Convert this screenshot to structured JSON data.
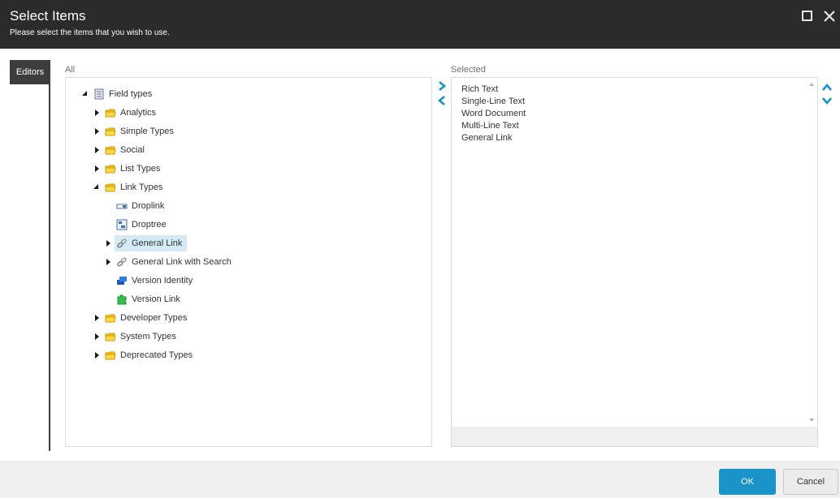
{
  "dialog": {
    "title": "Select Items",
    "subtitle": "Please select the items that you wish to use."
  },
  "sidebar": {
    "tab_label": "Editors"
  },
  "columns": {
    "all_label": "All",
    "selected_label": "Selected"
  },
  "tree": [
    {
      "label": "Field types",
      "icon": "template-icon",
      "state": "expanded"
    },
    {
      "label": "Analytics",
      "icon": "folder-icon",
      "state": "collapsed"
    },
    {
      "label": "Simple Types",
      "icon": "folder-icon",
      "state": "collapsed"
    },
    {
      "label": "Social",
      "icon": "folder-icon",
      "state": "collapsed"
    },
    {
      "label": "List Types",
      "icon": "folder-icon",
      "state": "collapsed"
    },
    {
      "label": "Link Types",
      "icon": "folder-icon",
      "state": "expanded"
    },
    {
      "label": "Droplink",
      "icon": "droplink-icon",
      "state": "leaf"
    },
    {
      "label": "Droptree",
      "icon": "droptree-icon",
      "state": "leaf"
    },
    {
      "label": "General Link",
      "icon": "link-chain-icon",
      "state": "collapsed",
      "selected": true
    },
    {
      "label": "General Link with Search",
      "icon": "link-chain-icon",
      "state": "collapsed"
    },
    {
      "label": "Version Identity",
      "icon": "version-identity-icon",
      "state": "leaf"
    },
    {
      "label": "Version Link",
      "icon": "puzzle-icon",
      "state": "leaf"
    },
    {
      "label": "Developer Types",
      "icon": "folder-icon",
      "state": "collapsed"
    },
    {
      "label": "System Types",
      "icon": "folder-icon",
      "state": "collapsed"
    },
    {
      "label": "Deprecated Types",
      "icon": "folder-icon",
      "state": "collapsed"
    }
  ],
  "selected_items": [
    "Rich Text",
    "Single-Line Text",
    "Word Document",
    "Multi-Line Text",
    "General Link"
  ],
  "controls": {
    "add": "chevron-right-icon",
    "remove": "chevron-left-icon",
    "move_up": "chevron-up-icon",
    "move_down": "chevron-down-icon"
  },
  "footer": {
    "ok_label": "OK",
    "cancel_label": "Cancel"
  },
  "colors": {
    "header_bg": "#2b2b2b",
    "accent": "#1a93c8",
    "selection": "#d4ebf6",
    "folder": "#f5c518"
  }
}
